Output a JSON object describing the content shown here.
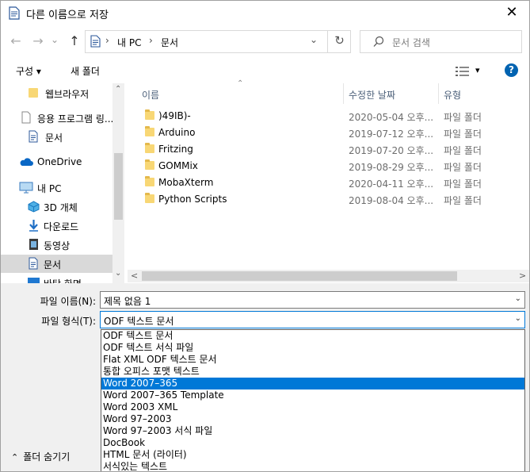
{
  "window": {
    "title": "다른 이름으로 저장",
    "close_glyph": "✕"
  },
  "nav": {
    "back_glyph": "←",
    "forward_glyph": "→",
    "recent_glyph": "⌄",
    "up_glyph": "↑",
    "address": {
      "crumbs": [
        "내 PC",
        "문서"
      ],
      "sep": "›",
      "expand_glyph": "⌄"
    },
    "refresh_glyph": "↻",
    "search": {
      "placeholder": "문서 검색",
      "icon_glyph": "⚲"
    }
  },
  "toolbar": {
    "organize_label": "구성",
    "organize_arrow": "▾",
    "new_folder_label": "새 폴더",
    "view_arrow": "▾",
    "help_glyph": "?"
  },
  "sidebar": {
    "items": [
      {
        "label": "웹브라우저",
        "icon": "folder-icon"
      },
      {
        "label": "응용 프로그램 링...",
        "icon": "file-icon"
      },
      {
        "label": "문서",
        "icon": "document-icon"
      },
      {
        "label": "OneDrive",
        "icon": "cloud-icon"
      },
      {
        "label": "내 PC",
        "icon": "computer-icon"
      },
      {
        "label": "3D 개체",
        "icon": "cube-icon"
      },
      {
        "label": "다운로드",
        "icon": "download-icon"
      },
      {
        "label": "동영상",
        "icon": "video-icon"
      },
      {
        "label": "문서",
        "icon": "document-icon",
        "selected": true
      },
      {
        "label": "바탕 화면",
        "icon": "desktop-icon"
      }
    ],
    "scroll_up": "⌃",
    "scroll_down": "⌄"
  },
  "filelist": {
    "columns": {
      "name": "이름",
      "modified": "수정한 날짜",
      "type": "유형"
    },
    "sort_indicator": "⌃",
    "rows": [
      {
        "name": ")49IB)-",
        "modified": "2020-05-04 오후...",
        "type": "파일 폴더"
      },
      {
        "name": "Arduino",
        "modified": "2019-07-12 오후...",
        "type": "파일 폴더"
      },
      {
        "name": "Fritzing",
        "modified": "2019-07-20 오후...",
        "type": "파일 폴더"
      },
      {
        "name": "GOMMix",
        "modified": "2019-08-29 오후...",
        "type": "파일 폴더"
      },
      {
        "name": "MobaXterm",
        "modified": "2020-04-11 오후...",
        "type": "파일 폴더"
      },
      {
        "name": "Python Scripts",
        "modified": "2019-08-04 오후...",
        "type": "파일 폴더"
      }
    ],
    "hscroll_left": "<",
    "hscroll_right": ">"
  },
  "save": {
    "filename_label": "파일 이름(N):",
    "filename_value": "제목 없음 1",
    "filetype_label": "파일 형식(T):",
    "filetype_value": "ODF 텍스트 문서",
    "dropdown_arrow": "⌄",
    "options": [
      "ODF 텍스트 문서",
      "ODF 텍스트 서식 파일",
      "Flat XML ODF 텍스트 문서",
      "통합 오피스 포맷 텍스트",
      "Word 2007–365",
      "Word 2007–365 Template",
      "Word 2003 XML",
      "Word 97–2003",
      "Word 97–2003 서식 파일",
      "DocBook",
      "HTML 문서 (라이터)",
      "서식있는 텍스트"
    ],
    "selected_option": "Word 2007–365"
  },
  "footer": {
    "hide_folders_label": "폴더 숨기기",
    "hide_folders_glyph": "⌃"
  },
  "colors": {
    "accent": "#0078d7",
    "selection": "#d9d9d9",
    "folder": "#f8d775",
    "help": "#0063b1"
  }
}
